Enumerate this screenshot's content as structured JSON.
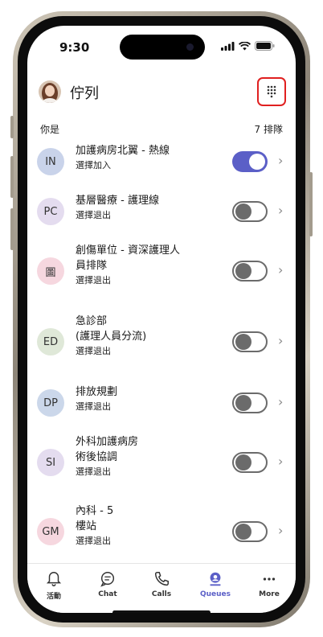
{
  "status_bar": {
    "time": "9:30"
  },
  "header": {
    "title": "佇列"
  },
  "subheader": {
    "you_are": "你是",
    "queue_count": "7 排隊"
  },
  "queues": [
    {
      "initials": "IN",
      "badge_color": "#c9d3ea",
      "name_lines": [
        "加護病房北翼 - 熱線"
      ],
      "status": "選擇加入",
      "enabled": true
    },
    {
      "initials": "PC",
      "badge_color": "#e4dcef",
      "name_lines": [
        "基層醫療 - 護理線"
      ],
      "status": "選擇退出",
      "enabled": false
    },
    {
      "initials": "圖",
      "badge_color": "#f6d7df",
      "name_lines": [
        "創傷單位 - 資深護理人",
        "員排隊"
      ],
      "status": "選擇退出",
      "enabled": false
    },
    {
      "initials": "ED",
      "badge_color": "#dfe8d8",
      "name_lines": [
        "急診部",
        " (護理人員分流)"
      ],
      "status": "選擇退出",
      "enabled": false
    },
    {
      "initials": "DP",
      "badge_color": "#cbd7ea",
      "name_lines": [
        "排放規劃"
      ],
      "status": "選擇退出",
      "enabled": false
    },
    {
      "initials": "SI",
      "badge_color": "#e4dcef",
      "name_lines": [
        "外科加護病房",
        "術後協調"
      ],
      "status": "選擇退出",
      "enabled": false
    },
    {
      "initials": "GM",
      "badge_color": "#f6d7df",
      "name_lines": [
        "內科 - 5",
        "樓站"
      ],
      "status": "選擇退出",
      "enabled": false
    }
  ],
  "tabs": [
    {
      "label": "活動",
      "icon": "bell-icon",
      "active": false
    },
    {
      "label": "Chat",
      "icon": "chat-icon",
      "active": false
    },
    {
      "label": "Calls",
      "icon": "phone-icon",
      "active": false
    },
    {
      "label": "Queues",
      "icon": "queues-icon",
      "active": true
    },
    {
      "label": "More",
      "icon": "more-icon",
      "active": false
    }
  ],
  "colors": {
    "accent": "#5b5fc7",
    "highlight_border": "#e02020"
  }
}
